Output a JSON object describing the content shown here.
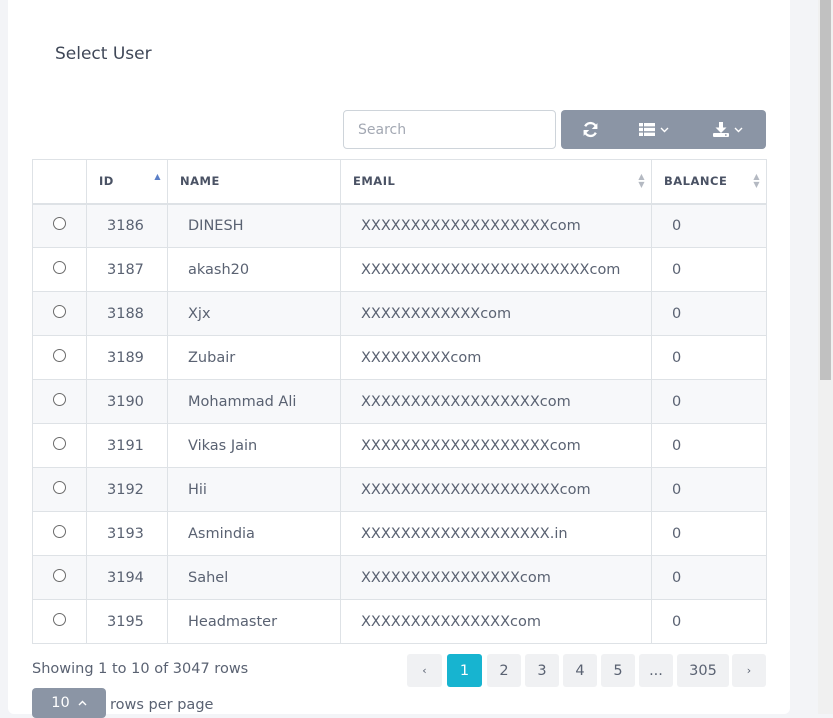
{
  "page": {
    "title": "Select User"
  },
  "toolbar": {
    "search_placeholder": "Search",
    "icons": {
      "refresh": "refresh-icon",
      "columns": "columns-icon",
      "export": "download-icon"
    },
    "color": "#8b95a5"
  },
  "table": {
    "columns": {
      "id": "ID",
      "name": "NAME",
      "email": "EMAIL",
      "balance": "BALANCE"
    },
    "rows": [
      {
        "id": "3186",
        "name": "DINESH",
        "email": "XXXXXXXXXXXXXXXXXXXcom",
        "balance": "0"
      },
      {
        "id": "3187",
        "name": "akash20",
        "email": "XXXXXXXXXXXXXXXXXXXXXXXcom",
        "balance": "0"
      },
      {
        "id": "3188",
        "name": "Xjx",
        "email": "XXXXXXXXXXXXcom",
        "balance": "0"
      },
      {
        "id": "3189",
        "name": "Zubair",
        "email": "XXXXXXXXXcom",
        "balance": "0"
      },
      {
        "id": "3190",
        "name": "Mohammad Ali",
        "email": "XXXXXXXXXXXXXXXXXXcom",
        "balance": "0"
      },
      {
        "id": "3191",
        "name": "Vikas Jain",
        "email": "XXXXXXXXXXXXXXXXXXXcom",
        "balance": "0"
      },
      {
        "id": "3192",
        "name": "Hii",
        "email": "XXXXXXXXXXXXXXXXXXXXcom",
        "balance": "0"
      },
      {
        "id": "3193",
        "name": "Asmindia",
        "email": "XXXXXXXXXXXXXXXXXXX.in",
        "balance": "0"
      },
      {
        "id": "3194",
        "name": "Sahel",
        "email": "XXXXXXXXXXXXXXXXcom",
        "balance": "0"
      },
      {
        "id": "3195",
        "name": "Headmaster",
        "email": "XXXXXXXXXXXXXXXcom",
        "balance": "0"
      }
    ]
  },
  "footer": {
    "showing": "Showing 1 to 10 of 3047 rows",
    "pagination": {
      "prev": "‹",
      "next": "›",
      "pages": [
        "1",
        "2",
        "3",
        "4",
        "5",
        "...",
        "305"
      ],
      "active_page": "1",
      "active_color": "#17b4d0"
    },
    "rows_per_page_value": "10",
    "rows_per_page_label": "rows per page"
  }
}
